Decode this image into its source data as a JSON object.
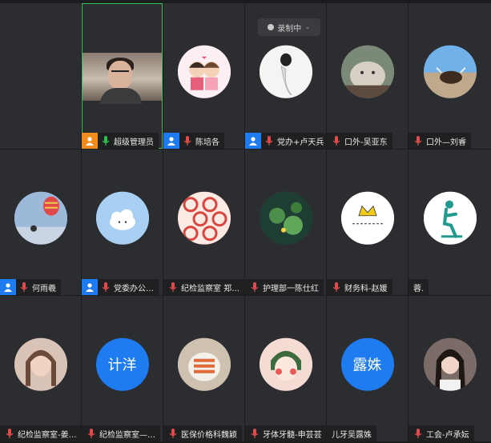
{
  "recording": {
    "label": "录制中"
  },
  "participants": [
    {
      "name": "",
      "avatar": "empty",
      "badge": "",
      "mic": false
    },
    {
      "name": "超级管理员",
      "avatar": "video",
      "badge": "orange",
      "mic": true,
      "active": true,
      "mic_color": "#2fbf4a"
    },
    {
      "name": "陈培各",
      "avatar": "cartoon-couple",
      "badge": "blue",
      "mic": true,
      "mic_color": "#e04b4b",
      "avatar_color": "#f6d3de"
    },
    {
      "name": "党办+卢天兵",
      "avatar": "ink-figure",
      "badge": "blue",
      "mic": true,
      "mic_color": "#e04b4b",
      "avatar_color": "#f2f2f2"
    },
    {
      "name": "口外-吴亚东",
      "avatar": "cat-photo",
      "badge": "",
      "mic": true,
      "mic_color": "#e04b4b",
      "avatar_color": "#a89a8a"
    },
    {
      "name": "口外—刘睿",
      "avatar": "yak-lake",
      "badge": "",
      "mic": true,
      "mic_color": "#e04b4b",
      "avatar_color": "#7fb4dc"
    },
    {
      "name": "何雨羲",
      "avatar": "balloon-sky",
      "badge": "blue",
      "mic": true,
      "mic_color": "#e04b4b",
      "avatar_color": "#8ab0d8"
    },
    {
      "name": "党委办公…",
      "avatar": "cloud-sky",
      "badge": "blue",
      "mic": true,
      "mic_color": "#e04b4b",
      "avatar_color": "#9cc8f0"
    },
    {
      "name": "纪检监察室 郑…",
      "avatar": "red-pattern",
      "badge": "",
      "mic": true,
      "mic_color": "#e04b4b",
      "avatar_color": "#d94a4a"
    },
    {
      "name": "护理部一陈仕红",
      "avatar": "lotus-pond",
      "badge": "",
      "mic": true,
      "mic_color": "#e04b4b",
      "avatar_color": "#2f6b4a"
    },
    {
      "name": "财务科-赵媛",
      "avatar": "crown-text",
      "badge": "",
      "mic": true,
      "mic_color": "#e04b4b",
      "avatar_color": "#ffffff"
    },
    {
      "name": "蓉.",
      "avatar": "teal-figure",
      "badge": "",
      "mic": false,
      "avatar_color": "#ffffff"
    },
    {
      "name": "纪检监察室-姜…",
      "avatar": "girl-photo",
      "badge": "",
      "mic": true,
      "mic_color": "#e04b4b",
      "avatar_color": "#c9a99a"
    },
    {
      "name": "纪检监察室—…",
      "avatar": "text",
      "text": "计洋",
      "badge": "",
      "mic": true,
      "mic_color": "#e04b4b",
      "avatar_color": "#1f7cf0"
    },
    {
      "name": "医保价格科魏颖",
      "avatar": "food-photo",
      "badge": "",
      "mic": true,
      "mic_color": "#e04b4b",
      "avatar_color": "#c7b8a6"
    },
    {
      "name": "牙体牙髓-申芸芸",
      "avatar": "cartoon-girl",
      "badge": "",
      "mic": true,
      "mic_color": "#e04b4b",
      "avatar_color": "#f4d6d0"
    },
    {
      "name": "儿牙吴露姝",
      "avatar": "text",
      "text": "露姝",
      "badge": "",
      "mic": false,
      "avatar_color": "#1f7cf0"
    },
    {
      "name": "工会-卢承妘",
      "avatar": "woman-photo",
      "badge": "",
      "mic": true,
      "mic_color": "#e04b4b",
      "avatar_color": "#6b5a55"
    }
  ]
}
